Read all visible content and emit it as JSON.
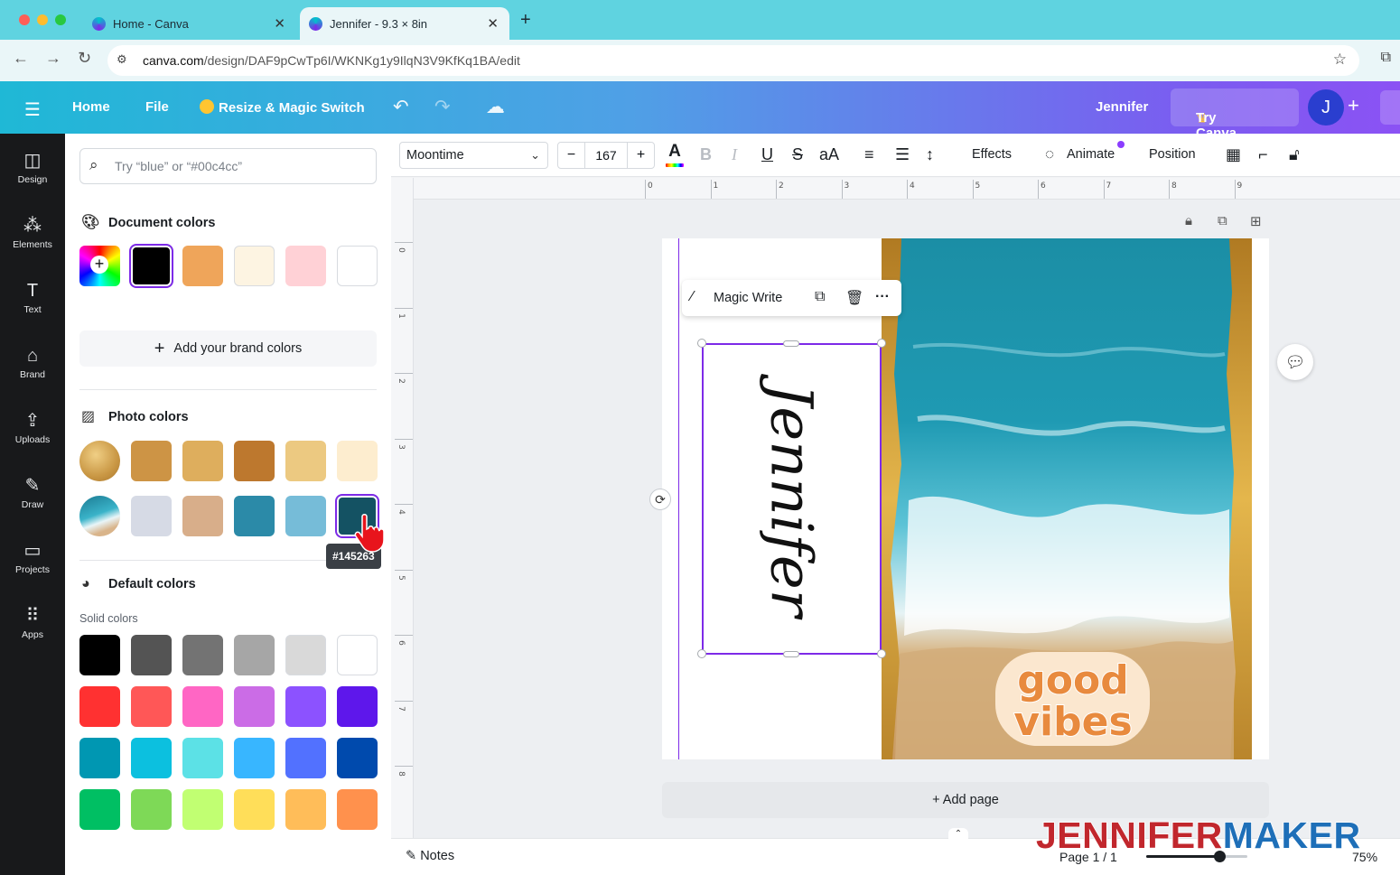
{
  "browser": {
    "tabs": [
      {
        "label": "Home - Canva"
      },
      {
        "label": "Jennifer - 9.3 × 8in"
      }
    ],
    "url_domain": "canva.com",
    "url_path": "/design/DAF9pCwTp6I/WKNKg1y9IlqN3V9KfKq1BA/edit"
  },
  "topbar": {
    "home": "Home",
    "file": "File",
    "resize": "Resize & Magic Switch",
    "design_name": "Jennifer",
    "try_pro": "Try Canva Pro",
    "avatar_initial": "J"
  },
  "rail": [
    {
      "label": "Design",
      "icon": "layout-icon"
    },
    {
      "label": "Elements",
      "icon": "elements-icon"
    },
    {
      "label": "Text",
      "icon": "text-icon"
    },
    {
      "label": "Brand",
      "icon": "brand-icon"
    },
    {
      "label": "Uploads",
      "icon": "upload-icon"
    },
    {
      "label": "Draw",
      "icon": "draw-icon"
    },
    {
      "label": "Projects",
      "icon": "folder-icon"
    },
    {
      "label": "Apps",
      "icon": "apps-icon"
    }
  ],
  "panel": {
    "search_placeholder": "Try “blue” or “#00c4cc”",
    "document_colors_title": "Document colors",
    "document_colors": [
      "#000000",
      "#efa55a",
      "#fdf4e2",
      "#ffd1d6",
      "#ffffff"
    ],
    "add_brand_colors": "Add your brand colors",
    "photo_colors_title": "Photo colors",
    "photo_colors_row1": [
      "#cd9445",
      "#deae5d",
      "#bd782e",
      "#ecc981",
      "#fdedcf"
    ],
    "photo_colors_row2": [
      "#d6dae5",
      "#d8ae8a",
      "#2b8aa8",
      "#76bcd8",
      "#145263"
    ],
    "selected_color_tooltip": "#145263",
    "default_colors_title": "Default colors",
    "solid_colors_label": "Solid colors",
    "solid_colors": [
      [
        "#000000",
        "#545454",
        "#737373",
        "#a6a6a6",
        "#d9d9d9",
        "#ffffff"
      ],
      [
        "#ff3131",
        "#ff5757",
        "#ff66c4",
        "#cb6ce6",
        "#8c52ff",
        "#5e17eb"
      ],
      [
        "#0097b2",
        "#0cc0df",
        "#5ce1e6",
        "#38b6ff",
        "#5271ff",
        "#004aad"
      ],
      [
        "#00bf63",
        "#7ed957",
        "#c1ff72",
        "#ffde59",
        "#ffbd59",
        "#ff914d"
      ]
    ]
  },
  "toolbar": {
    "font": "Moontime",
    "font_size": "167",
    "effects": "Effects",
    "animate": "Animate",
    "position": "Position"
  },
  "canvas": {
    "ruler_top": [
      "0",
      "1",
      "2",
      "3",
      "4",
      "5",
      "6",
      "7",
      "8",
      "9"
    ],
    "ruler_left": [
      "0",
      "1",
      "2",
      "3",
      "4",
      "5",
      "6",
      "7",
      "8"
    ],
    "text_content": "Jennifer",
    "sticker_text": [
      "good",
      "vibes"
    ],
    "magic_write": "Magic Write",
    "add_page": "+ Add page"
  },
  "footer": {
    "notes": "Notes",
    "page": "Page 1 / 1",
    "zoom": "75%",
    "zoom_level": 0.75
  },
  "watermark": {
    "part1": "JENNIFER",
    "part2": "MAKER"
  }
}
